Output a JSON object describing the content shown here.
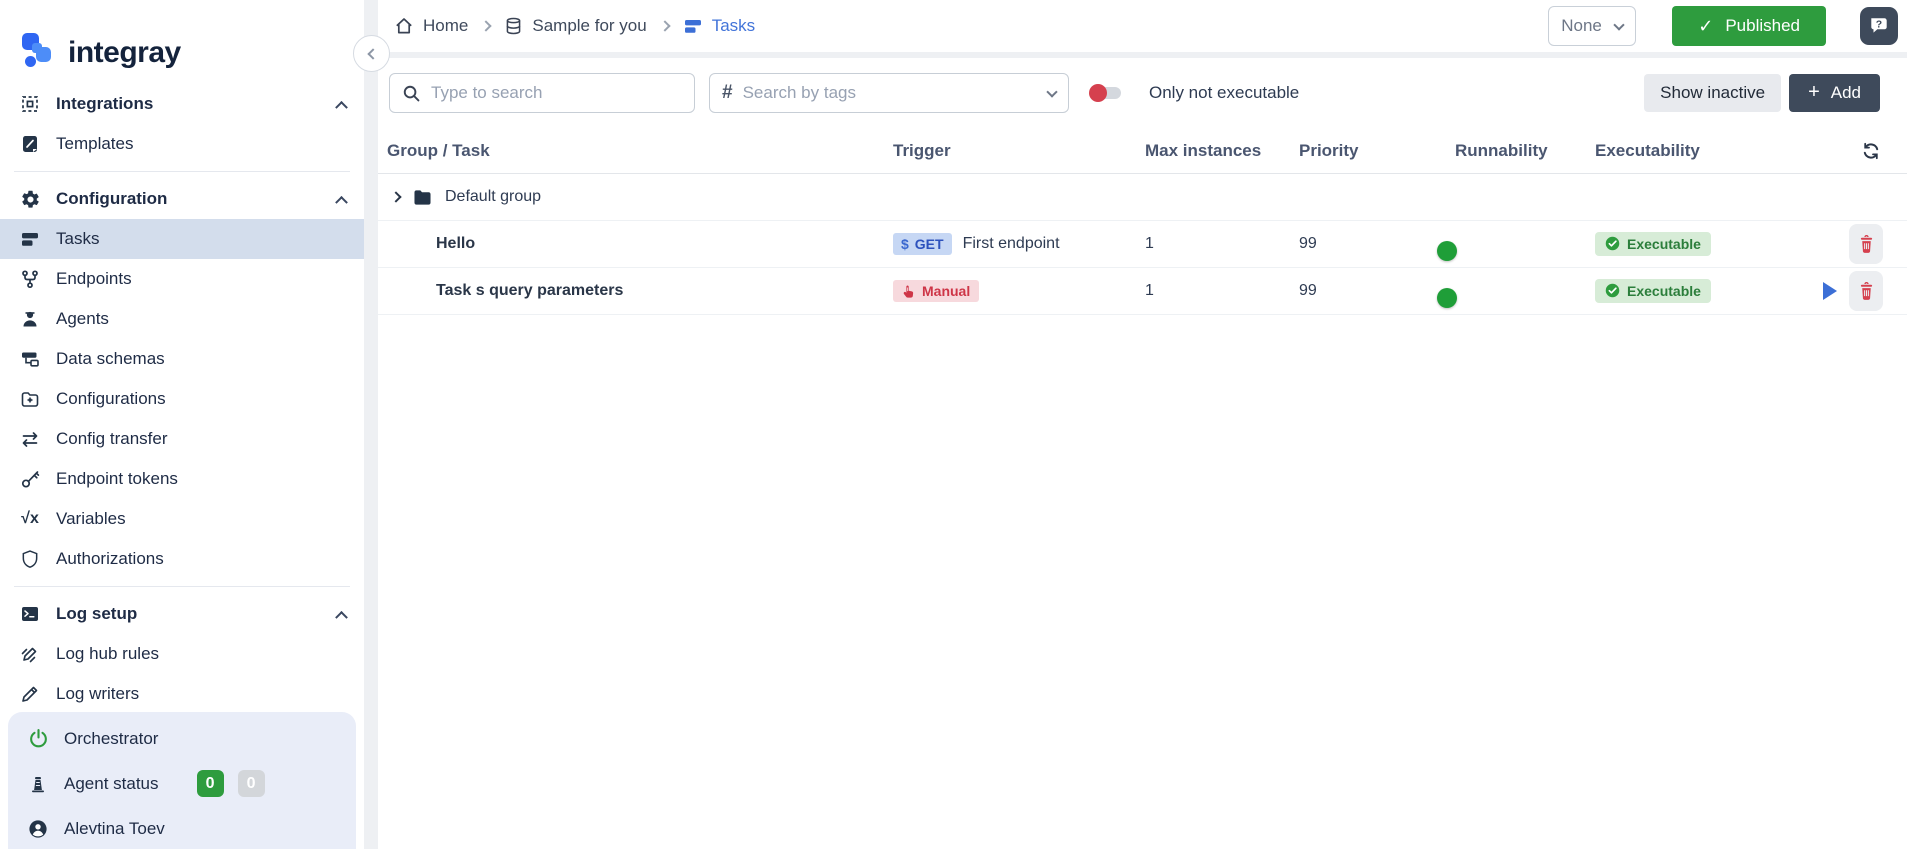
{
  "app": {
    "logo_text": "integray"
  },
  "colors": {
    "accent_blue": "#3c6fd6",
    "green": "#2e9c3e",
    "red": "#d5404e",
    "dark_button": "#3e4a5b",
    "selected_bg": "#d3ddec",
    "footer_bg": "#e9edf8",
    "get_badge_bg": "#c6d7f4",
    "manual_badge_bg": "#f7d9dd",
    "exec_badge_bg": "#d7ecd7"
  },
  "sidebar": {
    "sections": [
      {
        "items": [
          {
            "label": "Integrations"
          },
          {
            "label": "Templates"
          }
        ]
      },
      {
        "items": [
          {
            "label": "Configuration"
          },
          {
            "label": "Tasks"
          },
          {
            "label": "Endpoints"
          },
          {
            "label": "Agents"
          },
          {
            "label": "Data schemas"
          },
          {
            "label": "Configurations"
          },
          {
            "label": "Config transfer"
          },
          {
            "label": "Endpoint tokens"
          },
          {
            "label": "Variables"
          },
          {
            "label": "Authorizations"
          }
        ]
      },
      {
        "items": [
          {
            "label": "Log setup"
          },
          {
            "label": "Log hub rules"
          },
          {
            "label": "Log writers"
          }
        ]
      }
    ],
    "footer": {
      "items": [
        {
          "label": "Orchestrator"
        },
        {
          "label": "Agent status",
          "badges": [
            {
              "value": "0"
            },
            {
              "value": "0"
            }
          ]
        },
        {
          "label": "Alevtina Toev"
        }
      ]
    },
    "icons": {
      "variables_text": "√x"
    }
  },
  "topbar": {
    "breadcrumb": [
      {
        "label": "Home"
      },
      {
        "label": "Sample for you"
      },
      {
        "label": "Tasks"
      }
    ],
    "version_select_value": "None",
    "published_label": "Published",
    "help_label": "?"
  },
  "toolbar": {
    "search_placeholder": "Type to search",
    "tags_placeholder": "Search by tags",
    "filter_label": "Only not executable",
    "show_inactive_label": "Show inactive",
    "add_label": "Add"
  },
  "table": {
    "columns": {
      "group_task": "Group / Task",
      "trigger": "Trigger",
      "max_instances": "Max instances",
      "priority": "Priority",
      "runnability": "Runnability",
      "executability": "Executability"
    },
    "group_row": {
      "label": "Default group"
    },
    "rows": [
      {
        "name": "Hello",
        "trigger": {
          "badge_prefix": "$",
          "badge": "GET",
          "text": "First endpoint"
        },
        "max_instances": "1",
        "priority": "99",
        "executability_label": "Executable"
      },
      {
        "name": "Task s query parameters",
        "trigger": {
          "badge": "Manual"
        },
        "max_instances": "1",
        "priority": "99",
        "executability_label": "Executable"
      }
    ]
  }
}
